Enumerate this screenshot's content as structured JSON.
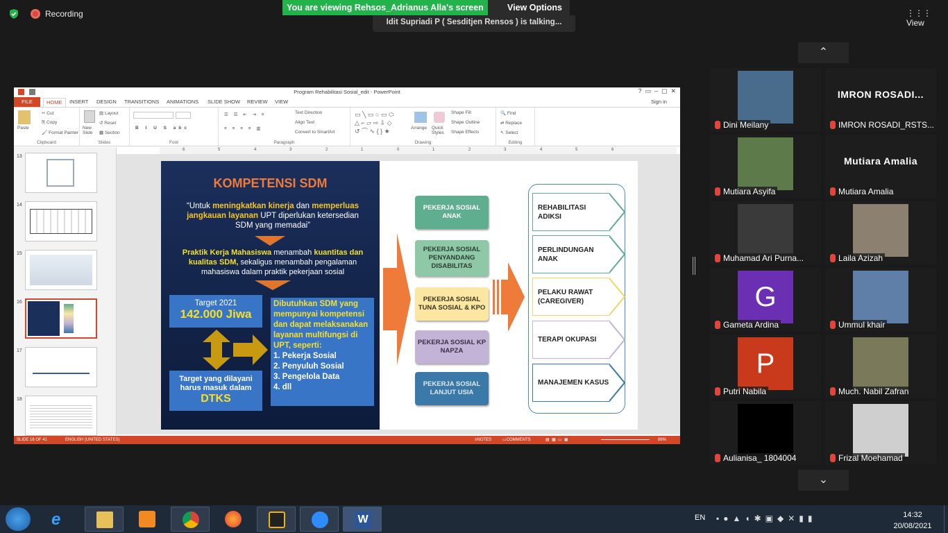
{
  "zoom": {
    "recording_label": "Recording",
    "viewing_banner": "You are viewing Rehsos_Adrianus Alla's screen",
    "view_options": "View Options",
    "talking": "Idit Supriadi P ( Sesditjen Rensos ) is talking...",
    "view_label": "View"
  },
  "ppt": {
    "window_title": "Program Rehabilitasi Sosial_edit - PowerPoint",
    "sign_in": "Sign in",
    "tabs": [
      "FILE",
      "HOME",
      "INSERT",
      "DESIGN",
      "TRANSITIONS",
      "ANIMATIONS",
      "SLIDE SHOW",
      "REVIEW",
      "VIEW"
    ],
    "ribbon": {
      "clipboard": "Clipboard",
      "paste": "Paste",
      "cut": "Cut",
      "copy": "Copy",
      "format_painter": "Format Painter",
      "slides": "Slides",
      "new_slide": "New Slide",
      "layout": "Layout",
      "reset": "Reset",
      "section": "Section",
      "font": "Font",
      "paragraph": "Paragraph",
      "text_direction": "Text Direction",
      "align_text": "Align Text",
      "convert_smartart": "Convert to SmartArt",
      "drawing": "Drawing",
      "arrange": "Arrange",
      "quick_styles": "Quick Styles",
      "shape_fill": "Shape Fill",
      "shape_outline": "Shape Outline",
      "shape_effects": "Shape Effects",
      "editing": "Editing",
      "find": "Find",
      "replace": "Replace",
      "select": "Select"
    },
    "ruler": [
      "6",
      "5",
      "4",
      "3",
      "2",
      "1",
      "0",
      "1",
      "2",
      "3",
      "4",
      "5",
      "6"
    ],
    "thumbnails": [
      "13",
      "14",
      "15",
      "16",
      "17",
      "18"
    ],
    "status": {
      "slide": "SLIDE 16 OF 41",
      "language": "ENGLISH (UNITED STATES)",
      "notes": "NOTES",
      "comments": "COMMENTS",
      "zoom": "86%"
    }
  },
  "slide": {
    "title": "KOMPETENSI SDM",
    "quote_1": "“Untuk ",
    "quote_b1": "meningkatkan kinerja",
    "quote_2": " dan ",
    "quote_b2": "memperluas jangkauan layanan",
    "quote_3": " UPT diperlukan ketersedian SDM yang memadai”",
    "pkm_b1": "Praktik Kerja Mahasiswa",
    "pkm_1": " menambah ",
    "pkm_b2": "kuantitas dan kualitas SDM,",
    "pkm_2": " sekaligus menambah pengalaman mahasiswa dalam praktik pekerjaan sosial",
    "target_label": "Target 2021",
    "target_value": "142.000 Jiwa",
    "dibutuhkan": "Dibutuhkan SDM yang mempunyai kompetensi dan dapat melaksanakan layanan multifungsi di UPT, seperti:",
    "list": [
      "1. Pekerja Sosial",
      "2. Penyuluh Sosial",
      "3. Pengelola Data",
      "4. dll"
    ],
    "dtks_label": "Target yang dilayani harus masuk dalam",
    "dtks_value": "DTKS",
    "pekerja": [
      {
        "label": "PEKERJA SOSIAL ANAK",
        "bg": "#5fae8f",
        "fg": "#ffffff"
      },
      {
        "label": "PEKERJA SOSIAL PENYANDANG DISABILITAS",
        "bg": "#8fc8a7",
        "fg": "#2a3e35"
      },
      {
        "label": "PEKERJA SOSIAL TUNA SOSIAL & KPO",
        "bg": "#fbe7a2",
        "fg": "#3a3420"
      },
      {
        "label": "PEKERJA SOSIAL KP NAPZA",
        "bg": "#c3b3d6",
        "fg": "#3a2f48"
      },
      {
        "label": "PEKERJA SOSIAL LANJUT USIA",
        "bg": "#3a79a8",
        "fg": "#dfe8f2"
      }
    ],
    "layanan": [
      {
        "label": "REHABILITASI ADIKSI",
        "color": "#5fae8f"
      },
      {
        "label": "PERLINDUNGAN ANAK",
        "color": "#5fae8f"
      },
      {
        "label": "PELAKU RAWAT (CAREGIVER)",
        "color": "#f4d465"
      },
      {
        "label": "TERAPI OKUPASI",
        "color": "#c3b3d6"
      },
      {
        "label": "MANAJEMEN KASUS",
        "color": "#3a79a8"
      }
    ]
  },
  "participants": [
    {
      "name": "Dini Meilany",
      "type": "photo",
      "color": "#4a6c8c"
    },
    {
      "name": "IMRON ROSADI_RSTS...",
      "type": "text",
      "big": "IMRON ROSADI..."
    },
    {
      "name": "Mutiara Asyifa",
      "type": "photo",
      "color": "#5c7a4a"
    },
    {
      "name": "Mutiara Amalia",
      "type": "text",
      "big": "Mutiara Amalia"
    },
    {
      "name": "Muhamad Ari Purna...",
      "type": "photo",
      "color": "#3a3a3a"
    },
    {
      "name": "Laila Azizah",
      "type": "photo",
      "color": "#8c8070"
    },
    {
      "name": "Gameta Ardina",
      "type": "letter",
      "letter": "G",
      "color": "#6b2fb3"
    },
    {
      "name": "Ummul khair",
      "type": "photo",
      "color": "#5f7fa8"
    },
    {
      "name": "Putri Nabila",
      "type": "letter",
      "letter": "P",
      "color": "#c9391b"
    },
    {
      "name": "Much. Nabil Zafran",
      "type": "photo",
      "color": "#7a7a5a"
    },
    {
      "name": "Aulianisa_ 1804004",
      "type": "black",
      "color": "#000000"
    },
    {
      "name": "Frizal Moehamad",
      "type": "photo",
      "color": "#cfcfcf"
    }
  ],
  "taskbar": {
    "lang": "EN",
    "time": "14:32",
    "date": "20/08/2021"
  }
}
